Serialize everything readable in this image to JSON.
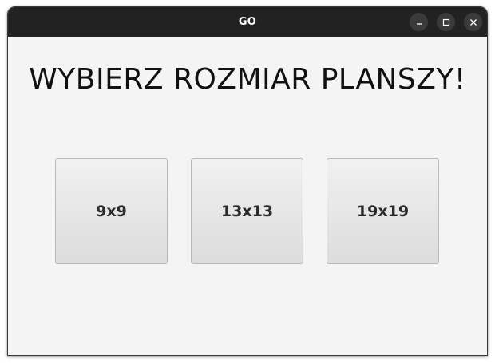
{
  "window": {
    "title": "GO",
    "controls": {
      "minimize_icon": "minimize-icon",
      "maximize_icon": "maximize-icon",
      "close_icon": "close-icon"
    }
  },
  "main": {
    "heading": "WYBIERZ ROZMIAR PLANSZY!",
    "size_buttons": [
      {
        "label": "9x9"
      },
      {
        "label": "13x13"
      },
      {
        "label": "19x19"
      }
    ]
  },
  "colors": {
    "titlebar": "#222222",
    "content_background": "#f4f4f4",
    "button_top": "#f1f1f1",
    "button_bottom": "#dcdcdc"
  }
}
